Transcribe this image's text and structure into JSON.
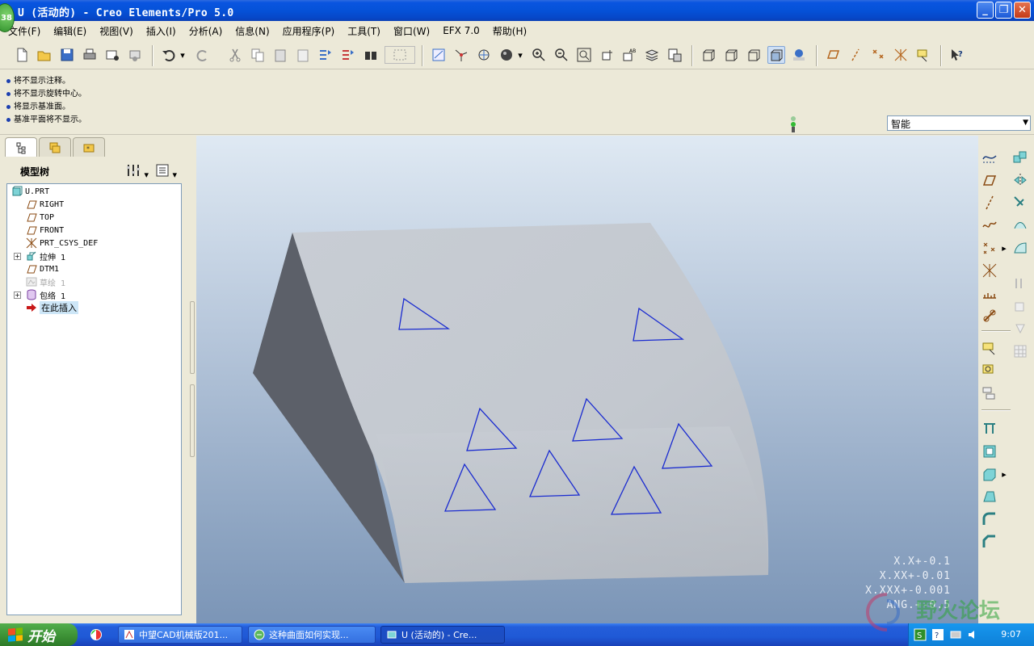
{
  "window": {
    "title": "U (活动的) - Creo Elements/Pro 5.0",
    "badge": "38"
  },
  "menu": [
    "文件(F)",
    "编辑(E)",
    "视图(V)",
    "插入(I)",
    "分析(A)",
    "信息(N)",
    "应用程序(P)",
    "工具(T)",
    "窗口(W)",
    "EFX 7.0",
    "帮助(H)"
  ],
  "messages": [
    "将不显示注释。",
    "将不显示旋转中心。",
    "将显示基准面。",
    "基准平面将不显示。"
  ],
  "filter": {
    "selected": "智能"
  },
  "model_tree": {
    "header": "模型树",
    "nodes": [
      {
        "label": "U.PRT",
        "icon": "part-icon"
      },
      {
        "label": "RIGHT",
        "icon": "datum-plane-icon"
      },
      {
        "label": "TOP",
        "icon": "datum-plane-icon"
      },
      {
        "label": "FRONT",
        "icon": "datum-plane-icon"
      },
      {
        "label": "PRT_CSYS_DEF",
        "icon": "csys-icon"
      },
      {
        "label": "拉伸 1",
        "icon": "extrude-icon",
        "expandable": true
      },
      {
        "label": "DTM1",
        "icon": "datum-plane-icon"
      },
      {
        "label": "草绘 1",
        "icon": "sketch-icon",
        "suppressed": true
      },
      {
        "label": "包络 1",
        "icon": "wrap-icon",
        "expandable": true
      },
      {
        "label": "在此插入",
        "icon": "insert-arrow-icon",
        "selected": true
      }
    ]
  },
  "tolerances": [
    "X.X+-0.1",
    "X.XX+-0.01",
    "X.XXX+-0.001",
    "ANG.+-0.5"
  ],
  "taskbar": {
    "start": "开始",
    "tasks": [
      "中望CAD机械版201...",
      "这种曲面如何实现...",
      "U (活动的) - Cre..."
    ],
    "clock": "9:07"
  },
  "watermark": "野火论坛",
  "colors": {
    "model_face": "#c9ced6",
    "model_side": "#5c6069",
    "sketch_lines": "#1a2bd0",
    "bg_top": "#dfe9f3",
    "bg_bottom": "#7b95b7"
  }
}
